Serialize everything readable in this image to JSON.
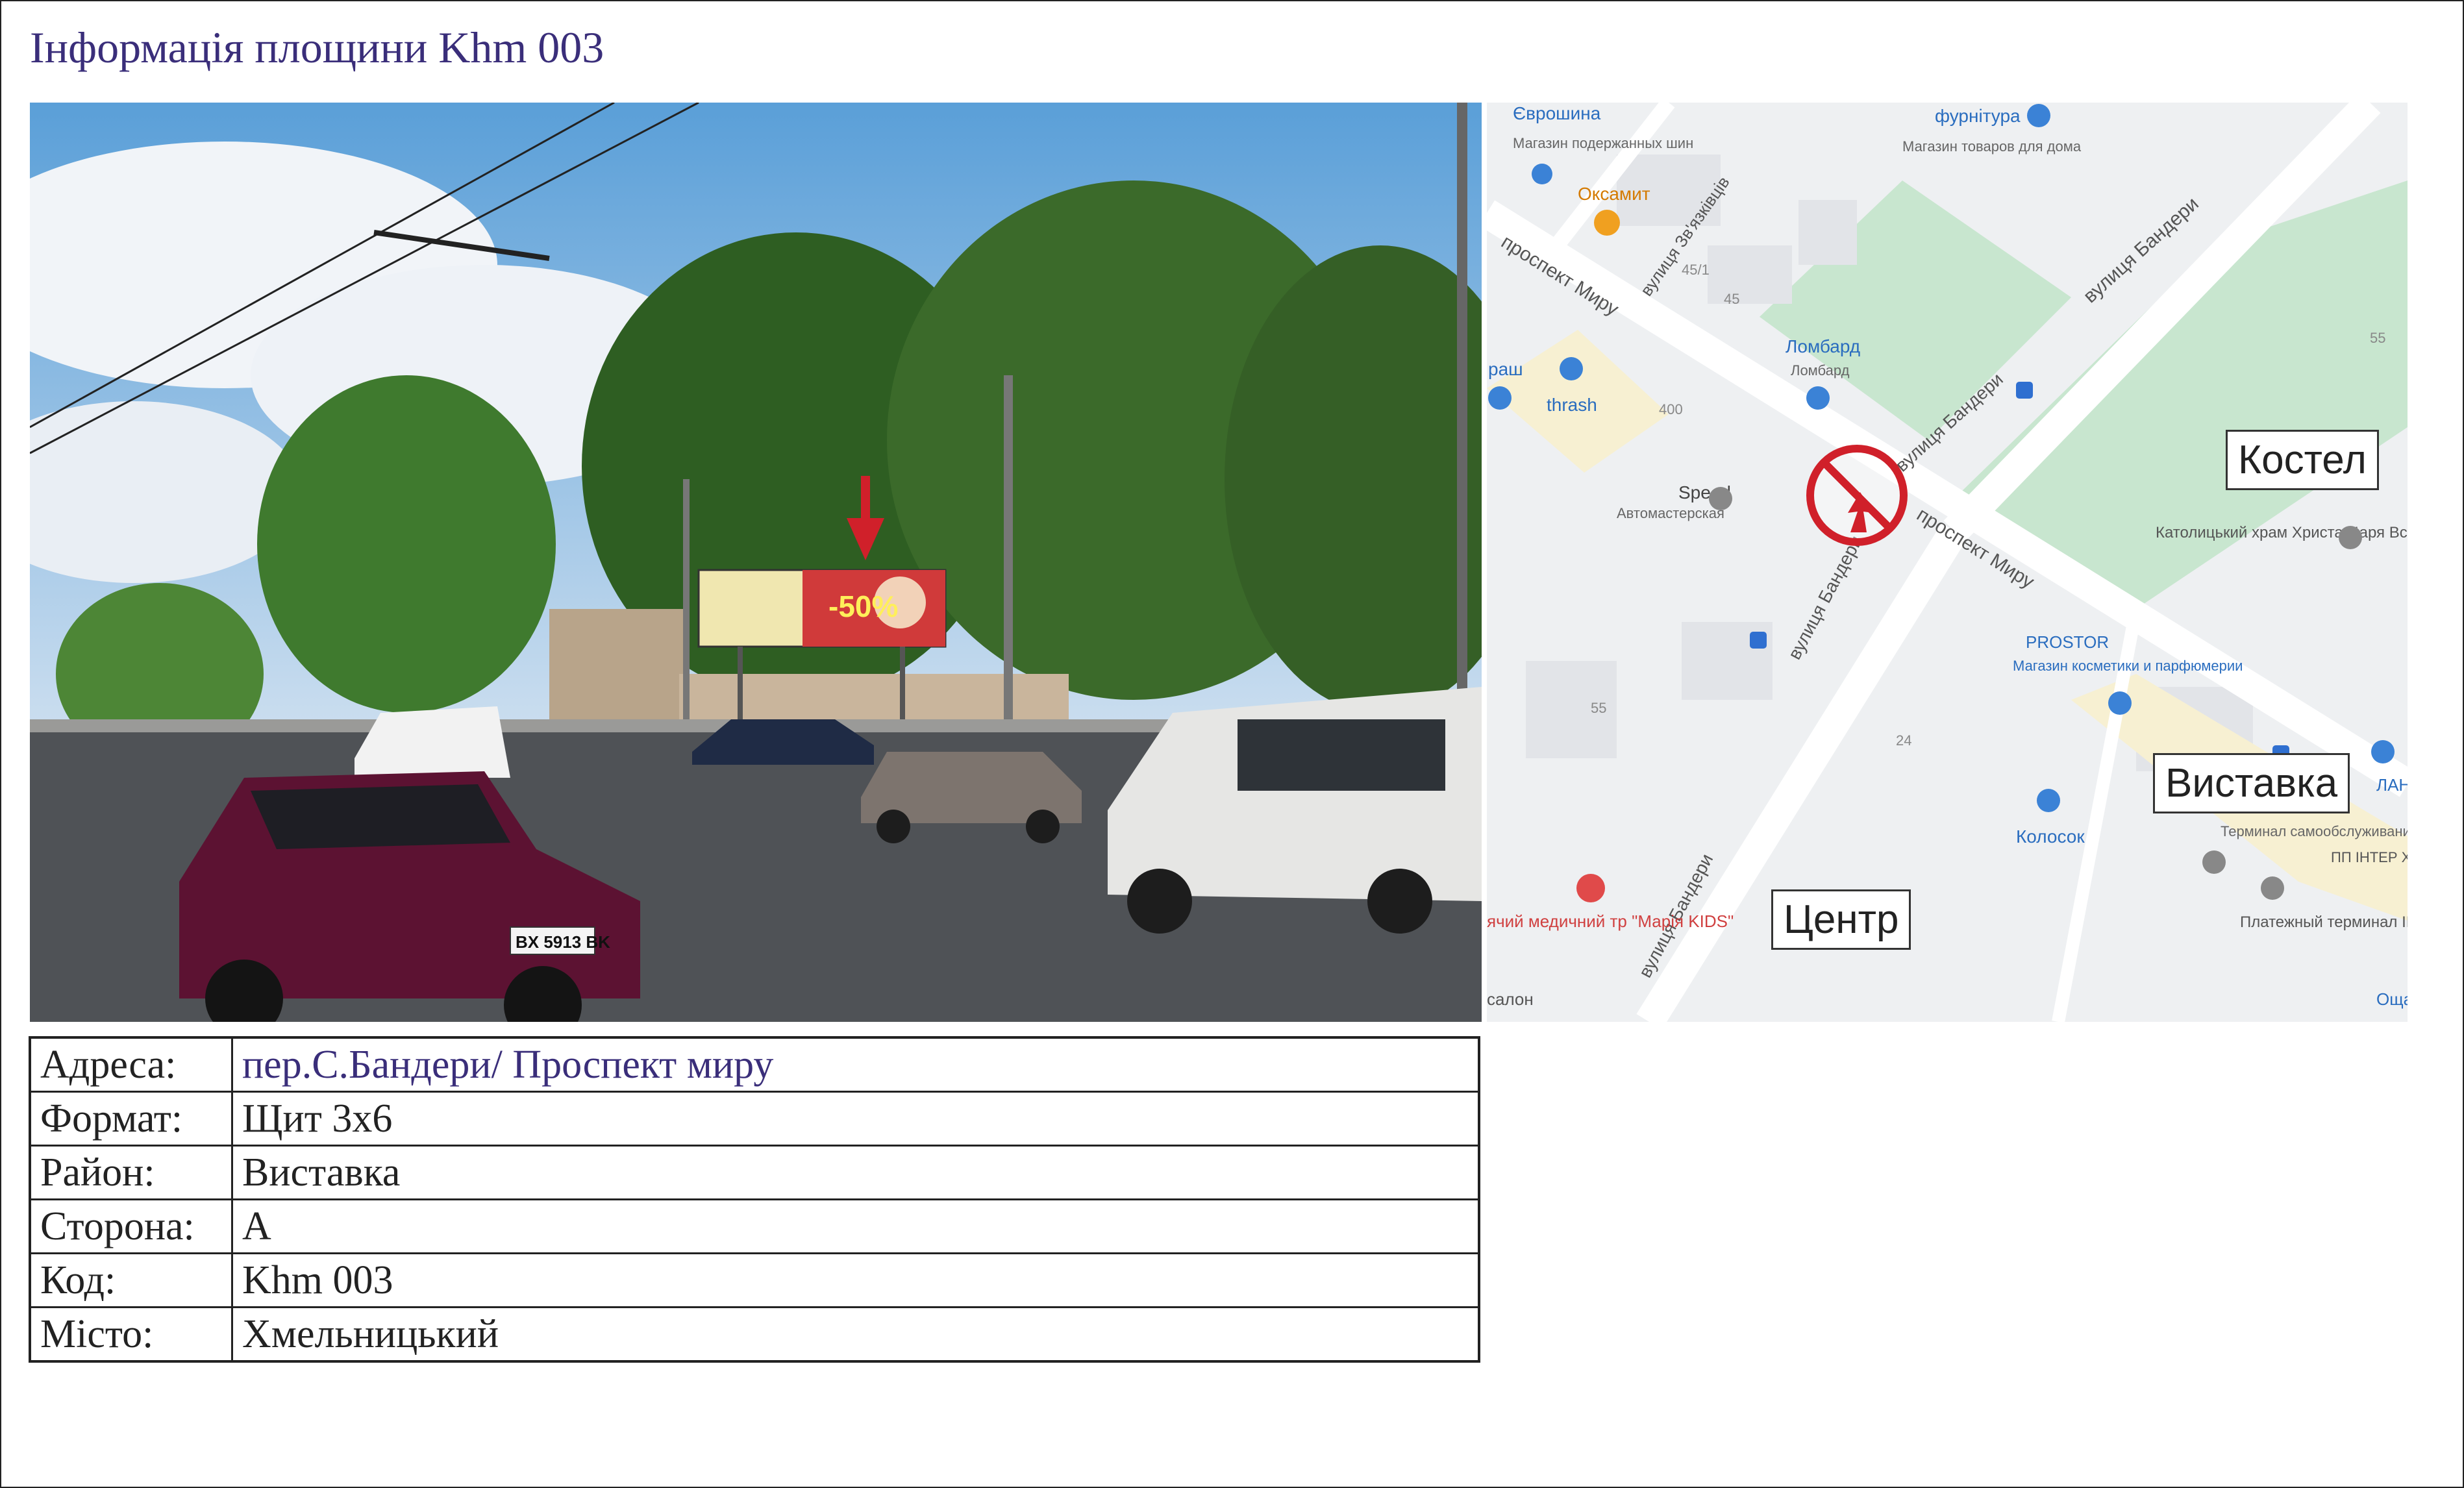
{
  "title": "Інформація площини Khm 003",
  "photo": {
    "plate": "BX 5913 BK"
  },
  "map": {
    "street_labels": {
      "prospekt_myru_top": "проспект Миру",
      "prospekt_myru_right": "проспект Миру",
      "banderi_top": "вулиця Бандери",
      "banderi_mid": "вулиця Бандери",
      "banderi_left": "вулиця Бандери",
      "banderi_bottom": "вулиця Бандери",
      "zvyazkivtsiv": "вулиця Зв'язківців"
    },
    "pois": {
      "evroshyna": "Єврошина",
      "evroshyna_sub": "Магазин подержанных шин",
      "furnitura": "фурнітура",
      "furnitura_sub": "Магазин товаров для дома",
      "oksamyt": "Оксамит",
      "lombard": "Ломбард",
      "lombard_sub": "Ломбард",
      "thrash": "thrash",
      "rash": "раш",
      "speed": "Speed",
      "speed_sub": "Автомастерская",
      "church": "Католицький храм Христа Царя Всесвіту",
      "prostor": "PROSTOR",
      "prostor_sub": "Магазин косметики и парфюмерии",
      "kolosok": "Колосок",
      "terminal": "Терминал самообслуживания",
      "pp_inter": "ПП ІНТЕР ХМЕЛЬНИ",
      "platezhnyi": "Платежный терминал IBOX",
      "medical": "ячий медичний тр \"Марія KIDS\"",
      "salon": "салон",
      "lan": "ЛАН",
      "osha": "Оща"
    },
    "building_numbers": [
      "45/1",
      "45",
      "400",
      "55",
      "55",
      "24"
    ],
    "labels": {
      "kostel": "Костел",
      "vystavka": "Виставка",
      "tsentr": "Центр"
    }
  },
  "info": [
    {
      "label": "Адреса:",
      "value": "пер.С.Бандери/ Проспект миру"
    },
    {
      "label": "Формат:",
      "value": "Щит 3х6"
    },
    {
      "label": "Район:",
      "value": "Виставка"
    },
    {
      "label": "Сторона:",
      "value": "А"
    },
    {
      "label": "Код:",
      "value": "Khm 003"
    },
    {
      "label": "Місто:",
      "value": "Хмельницький"
    }
  ],
  "colors": {
    "title": "#3a2e7a",
    "marker": "#d0202a",
    "park": "#c8e6cf"
  }
}
